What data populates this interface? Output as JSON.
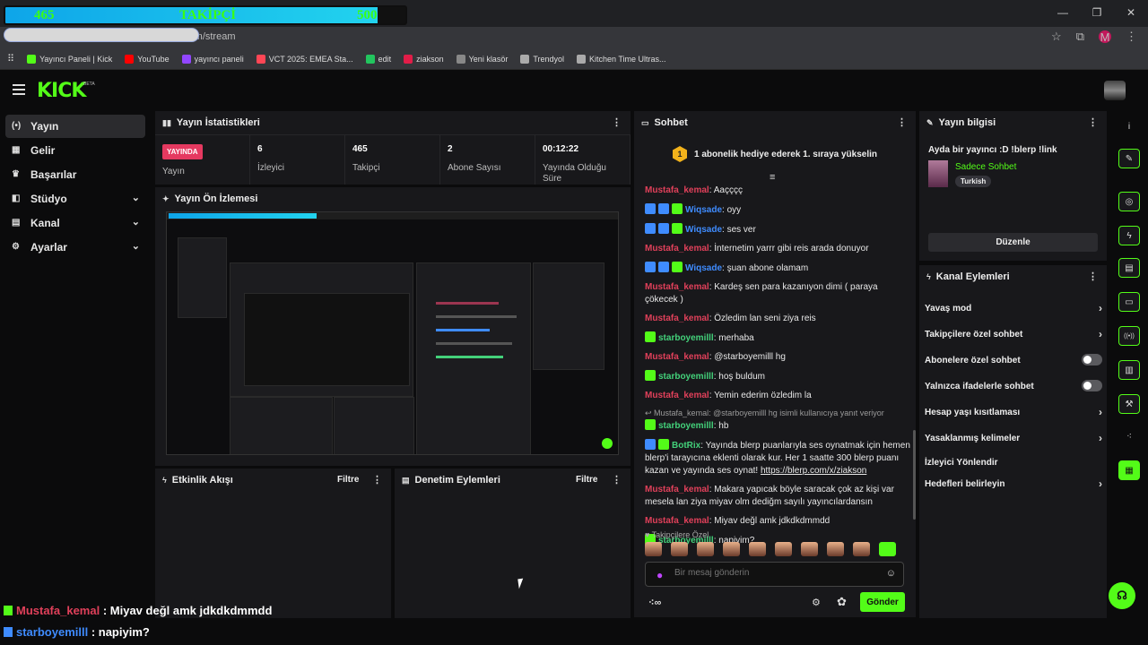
{
  "overlay": {
    "goal_current": "465",
    "goal_label": "TAKİPÇİ",
    "goal_target": "500",
    "goal_progress": 0.93,
    "chat": [
      {
        "user": "Mustafa_kemal",
        "sep": " : ",
        "text": "Miyav değl amk jdkdkdmmdd"
      },
      {
        "user": "starboyemilll",
        "sep": " : ",
        "text": "napiyim?"
      }
    ]
  },
  "browser": {
    "url": "dashboard.kick.com/stream",
    "profile_initial": "M",
    "bookmarks": [
      {
        "label": "Yayıncı Paneli | Kick",
        "color": "#53fc18"
      },
      {
        "label": "YouTube",
        "color": "#ff0000"
      },
      {
        "label": "yayıncı paneli",
        "color": "#9146ff"
      },
      {
        "label": "VCT 2025: EMEA Sta...",
        "color": "#ff4655"
      },
      {
        "label": "edit",
        "color": "#22c55e"
      },
      {
        "label": "ziakson",
        "color": "#e11d48"
      },
      {
        "label": "Yeni klasör",
        "color": "#888888"
      },
      {
        "label": "Trendyol",
        "color": "#aaaaaa"
      },
      {
        "label": "Kitchen Time Ultras...",
        "color": "#aaaaaa"
      }
    ]
  },
  "kick": {
    "logo": "KICK",
    "beta": "BETA"
  },
  "nav": [
    {
      "label": "Yayın",
      "icon": "broadcast-icon",
      "glyph": "(•)",
      "active": true,
      "chevron": false
    },
    {
      "label": "Gelir",
      "icon": "revenue-icon",
      "glyph": "▦",
      "chevron": false
    },
    {
      "label": "Başarılar",
      "icon": "trophy-icon",
      "glyph": "♛",
      "chevron": false
    },
    {
      "label": "Stüdyo",
      "icon": "studio-icon",
      "glyph": "◧",
      "chevron": true
    },
    {
      "label": "Kanal",
      "icon": "channel-icon",
      "glyph": "▤",
      "chevron": true
    },
    {
      "label": "Ayarlar",
      "icon": "settings-icon",
      "glyph": "⚙",
      "chevron": true
    }
  ],
  "stats": {
    "title": "Yayın İstatistikleri",
    "live_label": "YAYINDA",
    "items": [
      {
        "label": "Yayın",
        "value": ""
      },
      {
        "value": "6",
        "label": "İzleyici"
      },
      {
        "value": "465",
        "label": "Takipçi"
      },
      {
        "value": "2",
        "label": "Abone Sayısı"
      },
      {
        "value": "00:12:22",
        "label": "Yayında Olduğu Süre"
      }
    ]
  },
  "preview": {
    "title": "Yayın Ön İzlemesi"
  },
  "activity": {
    "title": "Etkinlik Akışı",
    "filter": "Filtre"
  },
  "moderation": {
    "title": "Denetim Eylemleri",
    "filter": "Filtre"
  },
  "chat": {
    "title": "Sohbet",
    "pinned_badge": "1",
    "pinned": "1 abonelik hediye ederek 1. sıraya yükselin",
    "messages": [
      {
        "user": "Mustafa_kemal",
        "color": "red",
        "badges": [],
        "text": ": Aaçççç"
      },
      {
        "user": "Wiqsade",
        "color": "blue",
        "badges": [
          "bl",
          "bl",
          "gr"
        ],
        "text": ": oyy"
      },
      {
        "user": "Wiqsade",
        "color": "blue",
        "badges": [
          "bl",
          "bl",
          "gr"
        ],
        "text": ": ses ver"
      },
      {
        "user": "Mustafa_kemal",
        "color": "red",
        "badges": [],
        "text": ": İnternetim yarrr gibi reis arada donuyor"
      },
      {
        "user": "Wiqsade",
        "color": "blue",
        "badges": [
          "bl",
          "bl",
          "gr"
        ],
        "text": ": şuan abone olamam"
      },
      {
        "user": "Mustafa_kemal",
        "color": "red",
        "badges": [],
        "text": ": Kardeş sen para kazanıyon dimi ( paraya çökecek )"
      },
      {
        "user": "Mustafa_kemal",
        "color": "red",
        "badges": [],
        "text": ": Özledim lan seni ziya reis"
      },
      {
        "user": "starboyemilll",
        "color": "green",
        "badges": [
          "gr"
        ],
        "text": ": merhaba"
      },
      {
        "user": "Mustafa_kemal",
        "color": "red",
        "badges": [],
        "text": ": @starboyemilll hg"
      },
      {
        "user": "starboyemilll",
        "color": "green",
        "badges": [
          "gr"
        ],
        "text": ": hoş buldum"
      },
      {
        "user": "Mustafa_kemal",
        "color": "red",
        "badges": [],
        "text": ": Yemin ederim özledim la"
      },
      {
        "reply": "↩ Mustafa_kemal: @starboyemilll hg isimli kullanıcıya yanıt veriyor",
        "user": "starboyemilll",
        "color": "green",
        "badges": [
          "gr"
        ],
        "text": ": hb"
      },
      {
        "user": "BotRix",
        "color": "bot",
        "badges": [
          "bl",
          "gr"
        ],
        "text": ": Yayında blerp puanlarıyla ses oynatmak için hemen blerp'i tarayıcına eklenti olarak kur. Her 1 saatte 300 blerp puanı kazan ve yayında ses oynat! ",
        "link": "https://blerp.com/x/ziakson"
      },
      {
        "user": "Mustafa_kemal",
        "color": "red",
        "badges": [],
        "text": ": Makara yapıcak böyle saracak çok az kişi var mesela lan ziya miyav olm dediğm sayılı yayıncılardansın"
      },
      {
        "user": "Mustafa_kemal",
        "color": "red",
        "badges": [],
        "text": ": Miyav değl amk jdkdkdmmdd"
      },
      {
        "user": "starboyemilll",
        "color": "green",
        "badges": [
          "gr"
        ],
        "text": ": napiyim?"
      }
    ],
    "emote_section": "♥ Takipçilere Özel",
    "input_placeholder": "Bir mesaj gönderin",
    "send_label": "Gönder"
  },
  "stream_info": {
    "title": "Yayın bilgisi",
    "stream_title": "Ayda bir yayıncı :D !blerp !link",
    "category": "Sadece Sohbet",
    "tag": "Turkish",
    "edit_label": "Düzenle"
  },
  "channel_actions": {
    "title": "Kanal Eylemleri",
    "items": [
      {
        "label": "Yavaş mod",
        "type": "chevron"
      },
      {
        "label": "Takipçilere özel sohbet",
        "type": "chevron"
      },
      {
        "label": "Abonelere özel sohbet",
        "type": "toggle"
      },
      {
        "label": "Yalnızca ifadelerle sohbet",
        "type": "toggle"
      },
      {
        "label": "Hesap yaşı kısıtlaması",
        "type": "chevron"
      },
      {
        "label": "Yasaklanmış kelimeler",
        "type": "chevron"
      },
      {
        "label": "İzleyici Yönlendir",
        "type": "none"
      },
      {
        "label": "Hedefleri belirleyin",
        "type": "chevron"
      }
    ]
  },
  "rail": [
    {
      "name": "info-icon",
      "glyph": "i",
      "style": "plain"
    },
    {
      "name": "pencil-icon",
      "glyph": "✎",
      "style": "outline"
    },
    {
      "name": "target-icon",
      "glyph": "◎",
      "style": "outline"
    },
    {
      "name": "lightning-icon",
      "glyph": "ϟ",
      "style": "outline"
    },
    {
      "name": "document-icon",
      "glyph": "▤",
      "style": "outline"
    },
    {
      "name": "chat-bubble-icon",
      "glyph": "▭",
      "style": "outline"
    },
    {
      "name": "broadcast-icon",
      "glyph": "((•))",
      "style": "outline"
    },
    {
      "name": "layout-icon",
      "glyph": "▥",
      "style": "outline"
    },
    {
      "name": "wrench-icon",
      "glyph": "⚒",
      "style": "outline"
    },
    {
      "name": "share-icon",
      "glyph": "⁖",
      "style": "plain"
    },
    {
      "name": "clapper-icon",
      "glyph": "▦",
      "style": "fill"
    }
  ]
}
